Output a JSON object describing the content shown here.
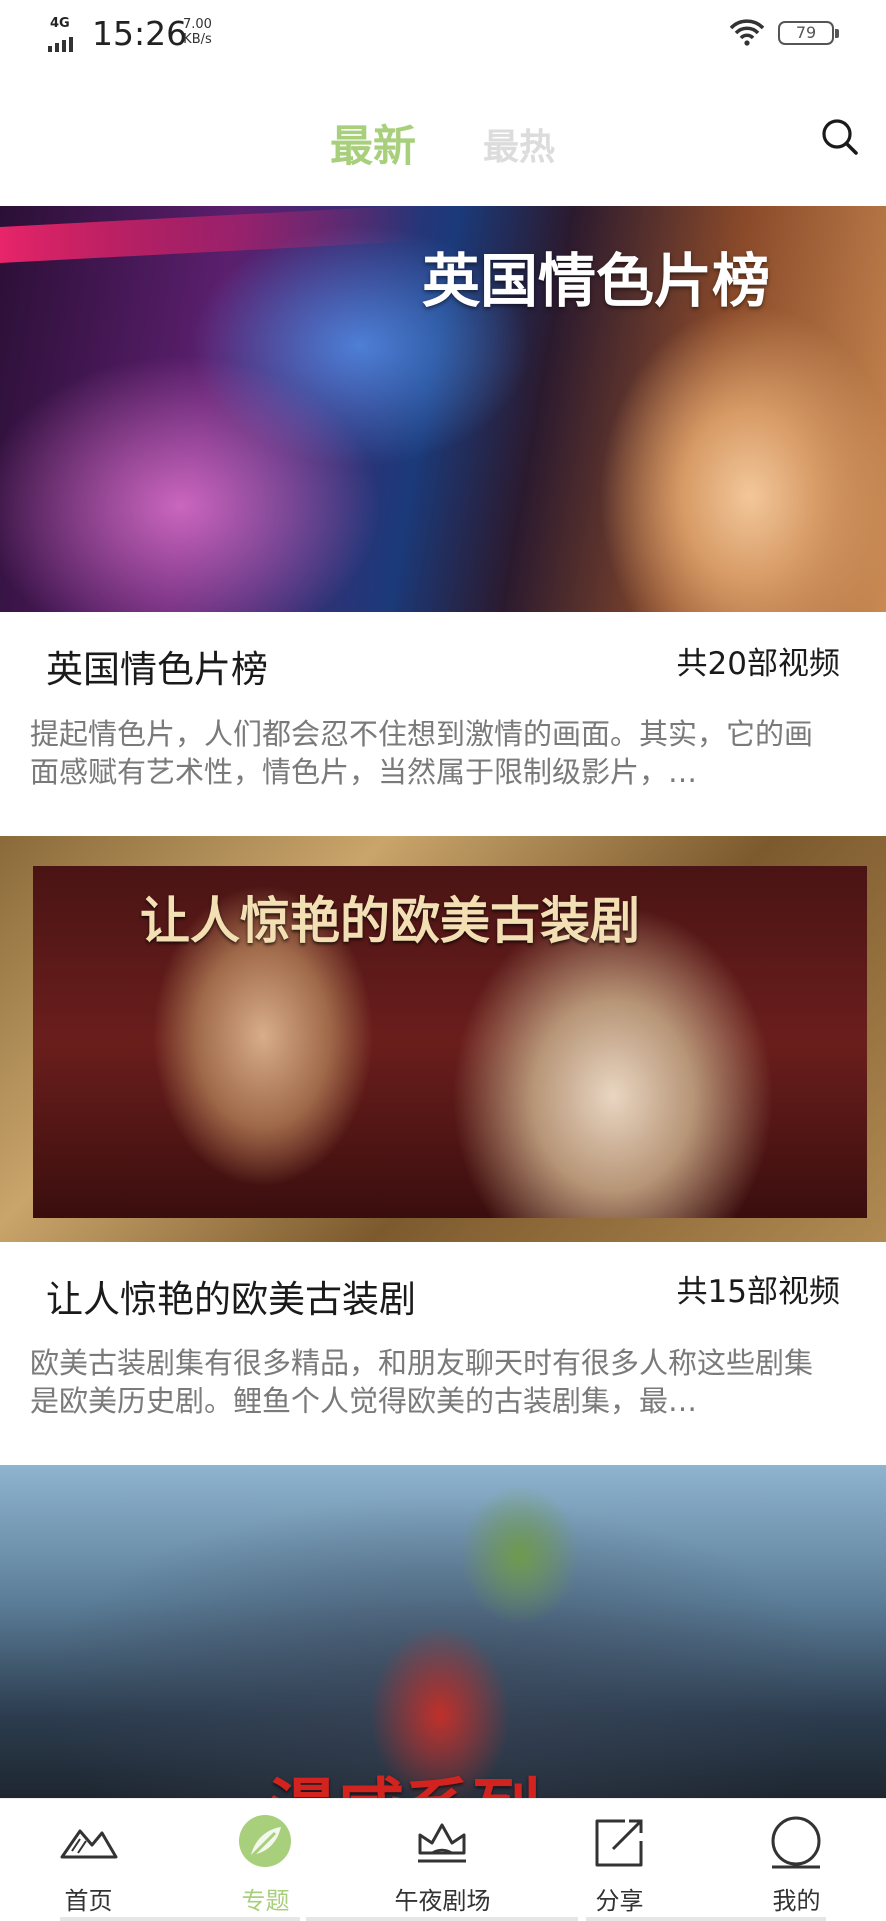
{
  "status_bar": {
    "network": "4G",
    "time": "15:26",
    "speed_value": "7.00",
    "speed_unit": "KB/s",
    "battery": "79"
  },
  "tabs": [
    {
      "label": "最新",
      "active": true
    },
    {
      "label": "最热",
      "active": false
    }
  ],
  "colors": {
    "accent": "#a8cf7c",
    "inactive_tab": "#dcdcdc",
    "desc_text": "#7a7a7a"
  },
  "cards": [
    {
      "banner_text": "英国情色片榜",
      "title": "英国情色片榜",
      "count": "共20部视频",
      "description": "提起情色片，人们都会忍不住想到激情的画面。其实，它的画面感赋有艺术性，情色片，当然属于限制级影片，…"
    },
    {
      "banner_text": "让人惊艳的欧美古装剧",
      "title": "让人惊艳的欧美古装剧",
      "count": "共15部视频",
      "description": "欧美古装剧集有很多精品，和朋友聊天时有很多人称这些剧集是欧美历史剧。鲤鱼个人觉得欧美的古装剧集，最…"
    },
    {
      "banner_text": "漫威系列"
    }
  ],
  "bottom_nav": [
    {
      "label": "首页",
      "icon": "mountains-icon",
      "active": false
    },
    {
      "label": "专题",
      "icon": "topic-leaf-icon",
      "active": true
    },
    {
      "label": "午夜剧场",
      "icon": "crown-icon",
      "active": false
    },
    {
      "label": "分享",
      "icon": "share-icon",
      "active": false
    },
    {
      "label": "我的",
      "icon": "profile-icon",
      "active": false
    }
  ]
}
